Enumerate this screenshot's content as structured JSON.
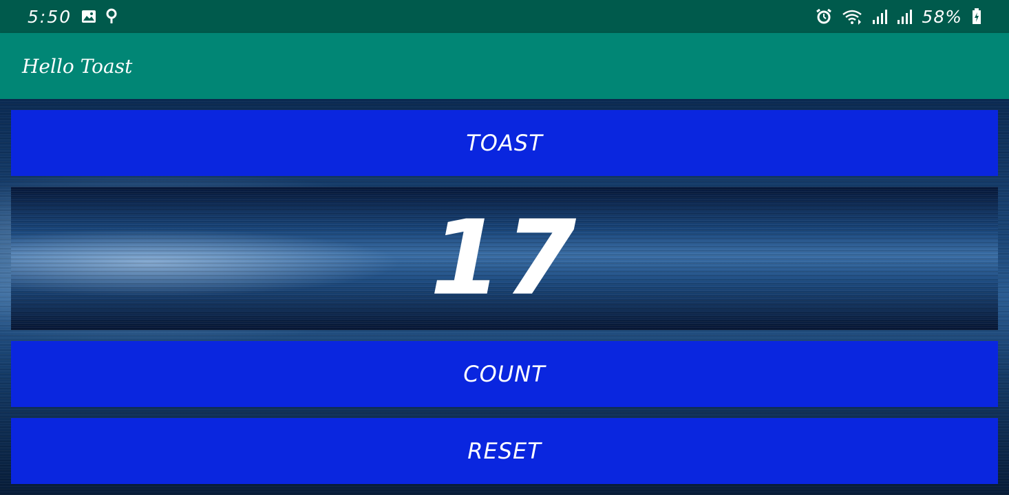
{
  "status_bar": {
    "time": "5:50",
    "battery_percent": "58%",
    "icons": [
      "image-icon",
      "location-icon",
      "alarm-icon",
      "wifi-icon",
      "signal-icon",
      "signal-icon",
      "battery-charging-icon"
    ]
  },
  "app_bar": {
    "title": "Hello Toast"
  },
  "buttons": {
    "toast": "TOAST",
    "count": "COUNT",
    "reset": "RESET"
  },
  "counter": {
    "value": "17"
  },
  "colors": {
    "status_bar": "#005a4c",
    "app_bar": "#018675",
    "button": "#0a26df",
    "text": "#ffffff"
  }
}
